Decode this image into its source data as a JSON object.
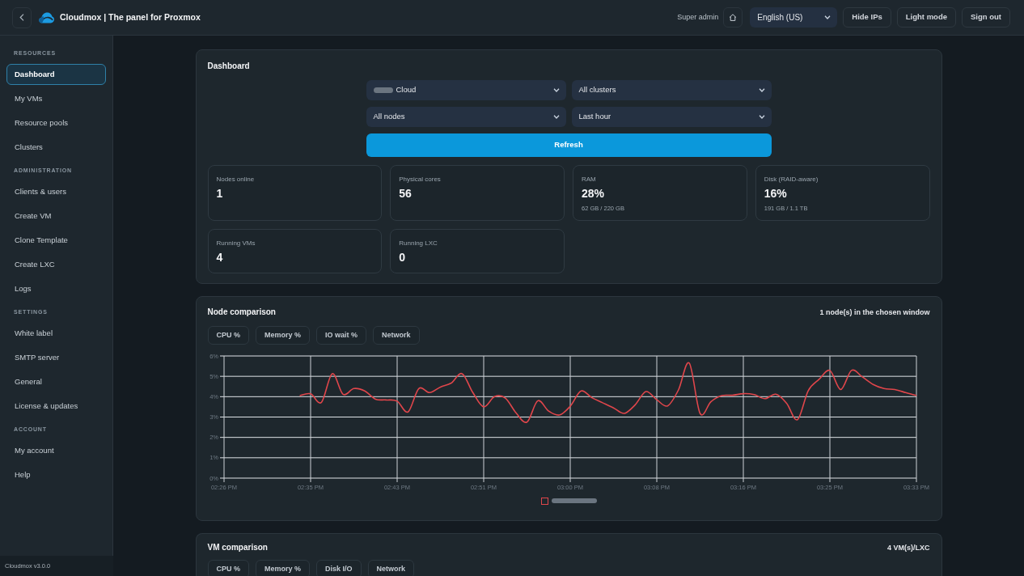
{
  "header": {
    "title": "Cloudmox | The panel for Proxmox",
    "user_role": "Super admin",
    "language": "English (US)",
    "buttons": [
      "Hide IPs",
      "Light mode",
      "Sign out"
    ]
  },
  "sidebar": {
    "sections": [
      {
        "heading": "RESOURCES",
        "items": [
          {
            "label": "Dashboard",
            "selected": true
          },
          {
            "label": "My VMs",
            "selected": false
          },
          {
            "label": "Resource pools",
            "selected": false
          },
          {
            "label": "Clusters",
            "selected": false
          }
        ]
      },
      {
        "heading": "ADMINISTRATION",
        "items": [
          {
            "label": "Clients & users",
            "selected": false
          },
          {
            "label": "Create VM",
            "selected": false
          },
          {
            "label": "Clone Template",
            "selected": false
          },
          {
            "label": "Create LXC",
            "selected": false
          },
          {
            "label": "Logs",
            "selected": false
          }
        ]
      },
      {
        "heading": "SETTINGS",
        "items": [
          {
            "label": "White label",
            "selected": false
          },
          {
            "label": "SMTP server",
            "selected": false
          },
          {
            "label": "General",
            "selected": false
          },
          {
            "label": "License & updates",
            "selected": false
          }
        ]
      },
      {
        "heading": "ACCOUNT",
        "items": [
          {
            "label": "My account",
            "selected": false
          },
          {
            "label": "Help",
            "selected": false
          }
        ]
      }
    ],
    "version": "Cloudmox v3.0.0"
  },
  "dashboard": {
    "title": "Dashboard",
    "filters": [
      {
        "value": "Cloud",
        "redacted_prefix": true
      },
      {
        "value": "All clusters",
        "redacted_prefix": false
      },
      {
        "value": "All nodes",
        "redacted_prefix": false
      },
      {
        "value": "Last hour",
        "redacted_prefix": false
      }
    ],
    "refresh_button": "Refresh",
    "stats": [
      {
        "label": "Nodes online",
        "value": "1"
      },
      {
        "label": "Physical cores",
        "value": "56"
      },
      {
        "label": "RAM",
        "value": "28%",
        "detail": "62 GB / 220 GB"
      },
      {
        "label": "Disk (RAID-aware)",
        "value": "16%",
        "detail": "191 GB / 1.1 TB"
      },
      {
        "label": "Running VMs",
        "value": "4"
      },
      {
        "label": "Running LXC",
        "value": "0"
      }
    ]
  },
  "node_comparison": {
    "title": "Node comparison",
    "summary": "1 node(s) in the chosen window",
    "metric_tabs": [
      "CPU %",
      "Memory %",
      "IO wait %",
      "Network"
    ],
    "chart_data": {
      "type": "line",
      "grid": true,
      "categories": [
        "02:26 PM",
        null,
        null,
        null,
        null,
        null,
        null,
        null,
        "02:35 PM",
        null,
        null,
        null,
        null,
        null,
        null,
        null,
        "02:43 PM",
        null,
        null,
        null,
        null,
        null,
        null,
        null,
        "02:51 PM",
        null,
        null,
        null,
        null,
        null,
        null,
        null,
        "03:00 PM",
        null,
        null,
        null,
        null,
        null,
        null,
        null,
        "03:08 PM",
        null,
        null,
        null,
        null,
        null,
        null,
        null,
        "03:16 PM",
        null,
        null,
        null,
        null,
        null,
        null,
        null,
        "03:25 PM",
        null,
        null,
        null,
        null,
        null,
        null,
        null,
        "03:33 PM"
      ],
      "series": [
        {
          "color": "#e0464b",
          "values": [
            null,
            null,
            null,
            null,
            null,
            null,
            null,
            4.05,
            4.14,
            3.72,
            5.13,
            4.12,
            4.4,
            4.28,
            3.88,
            3.84,
            3.78,
            3.25,
            4.4,
            4.2,
            4.47,
            4.67,
            5.13,
            4.2,
            3.5,
            4.0,
            3.93,
            3.2,
            2.75,
            3.8,
            3.29,
            3.1,
            3.53,
            4.28,
            3.95,
            3.7,
            3.45,
            3.18,
            3.6,
            4.25,
            3.85,
            3.55,
            4.33,
            5.65,
            3.18,
            3.75,
            4.05,
            4.07,
            4.15,
            4.1,
            3.9,
            4.12,
            3.68,
            2.87,
            4.3,
            4.85,
            5.29,
            4.35,
            5.29,
            4.97,
            4.6,
            4.4,
            4.35,
            4.2,
            4.05
          ]
        }
      ],
      "ylim": [
        0,
        6
      ],
      "yticks": [
        {
          "value": 0,
          "label": "0%"
        },
        {
          "value": 1,
          "label": "1%"
        },
        {
          "value": 2,
          "label": "2%"
        },
        {
          "value": 3,
          "label": "3%"
        },
        {
          "value": 4,
          "label": "4%"
        },
        {
          "value": 5,
          "label": "5%"
        },
        {
          "value": 6,
          "label": "6%"
        }
      ]
    },
    "legend_label_redacted": true
  },
  "vm_comparison": {
    "title": "VM comparison",
    "summary": "4 VM(s)/LXC",
    "metric_tabs": [
      "CPU %",
      "Memory %",
      "Disk I/O",
      "Network"
    ]
  }
}
